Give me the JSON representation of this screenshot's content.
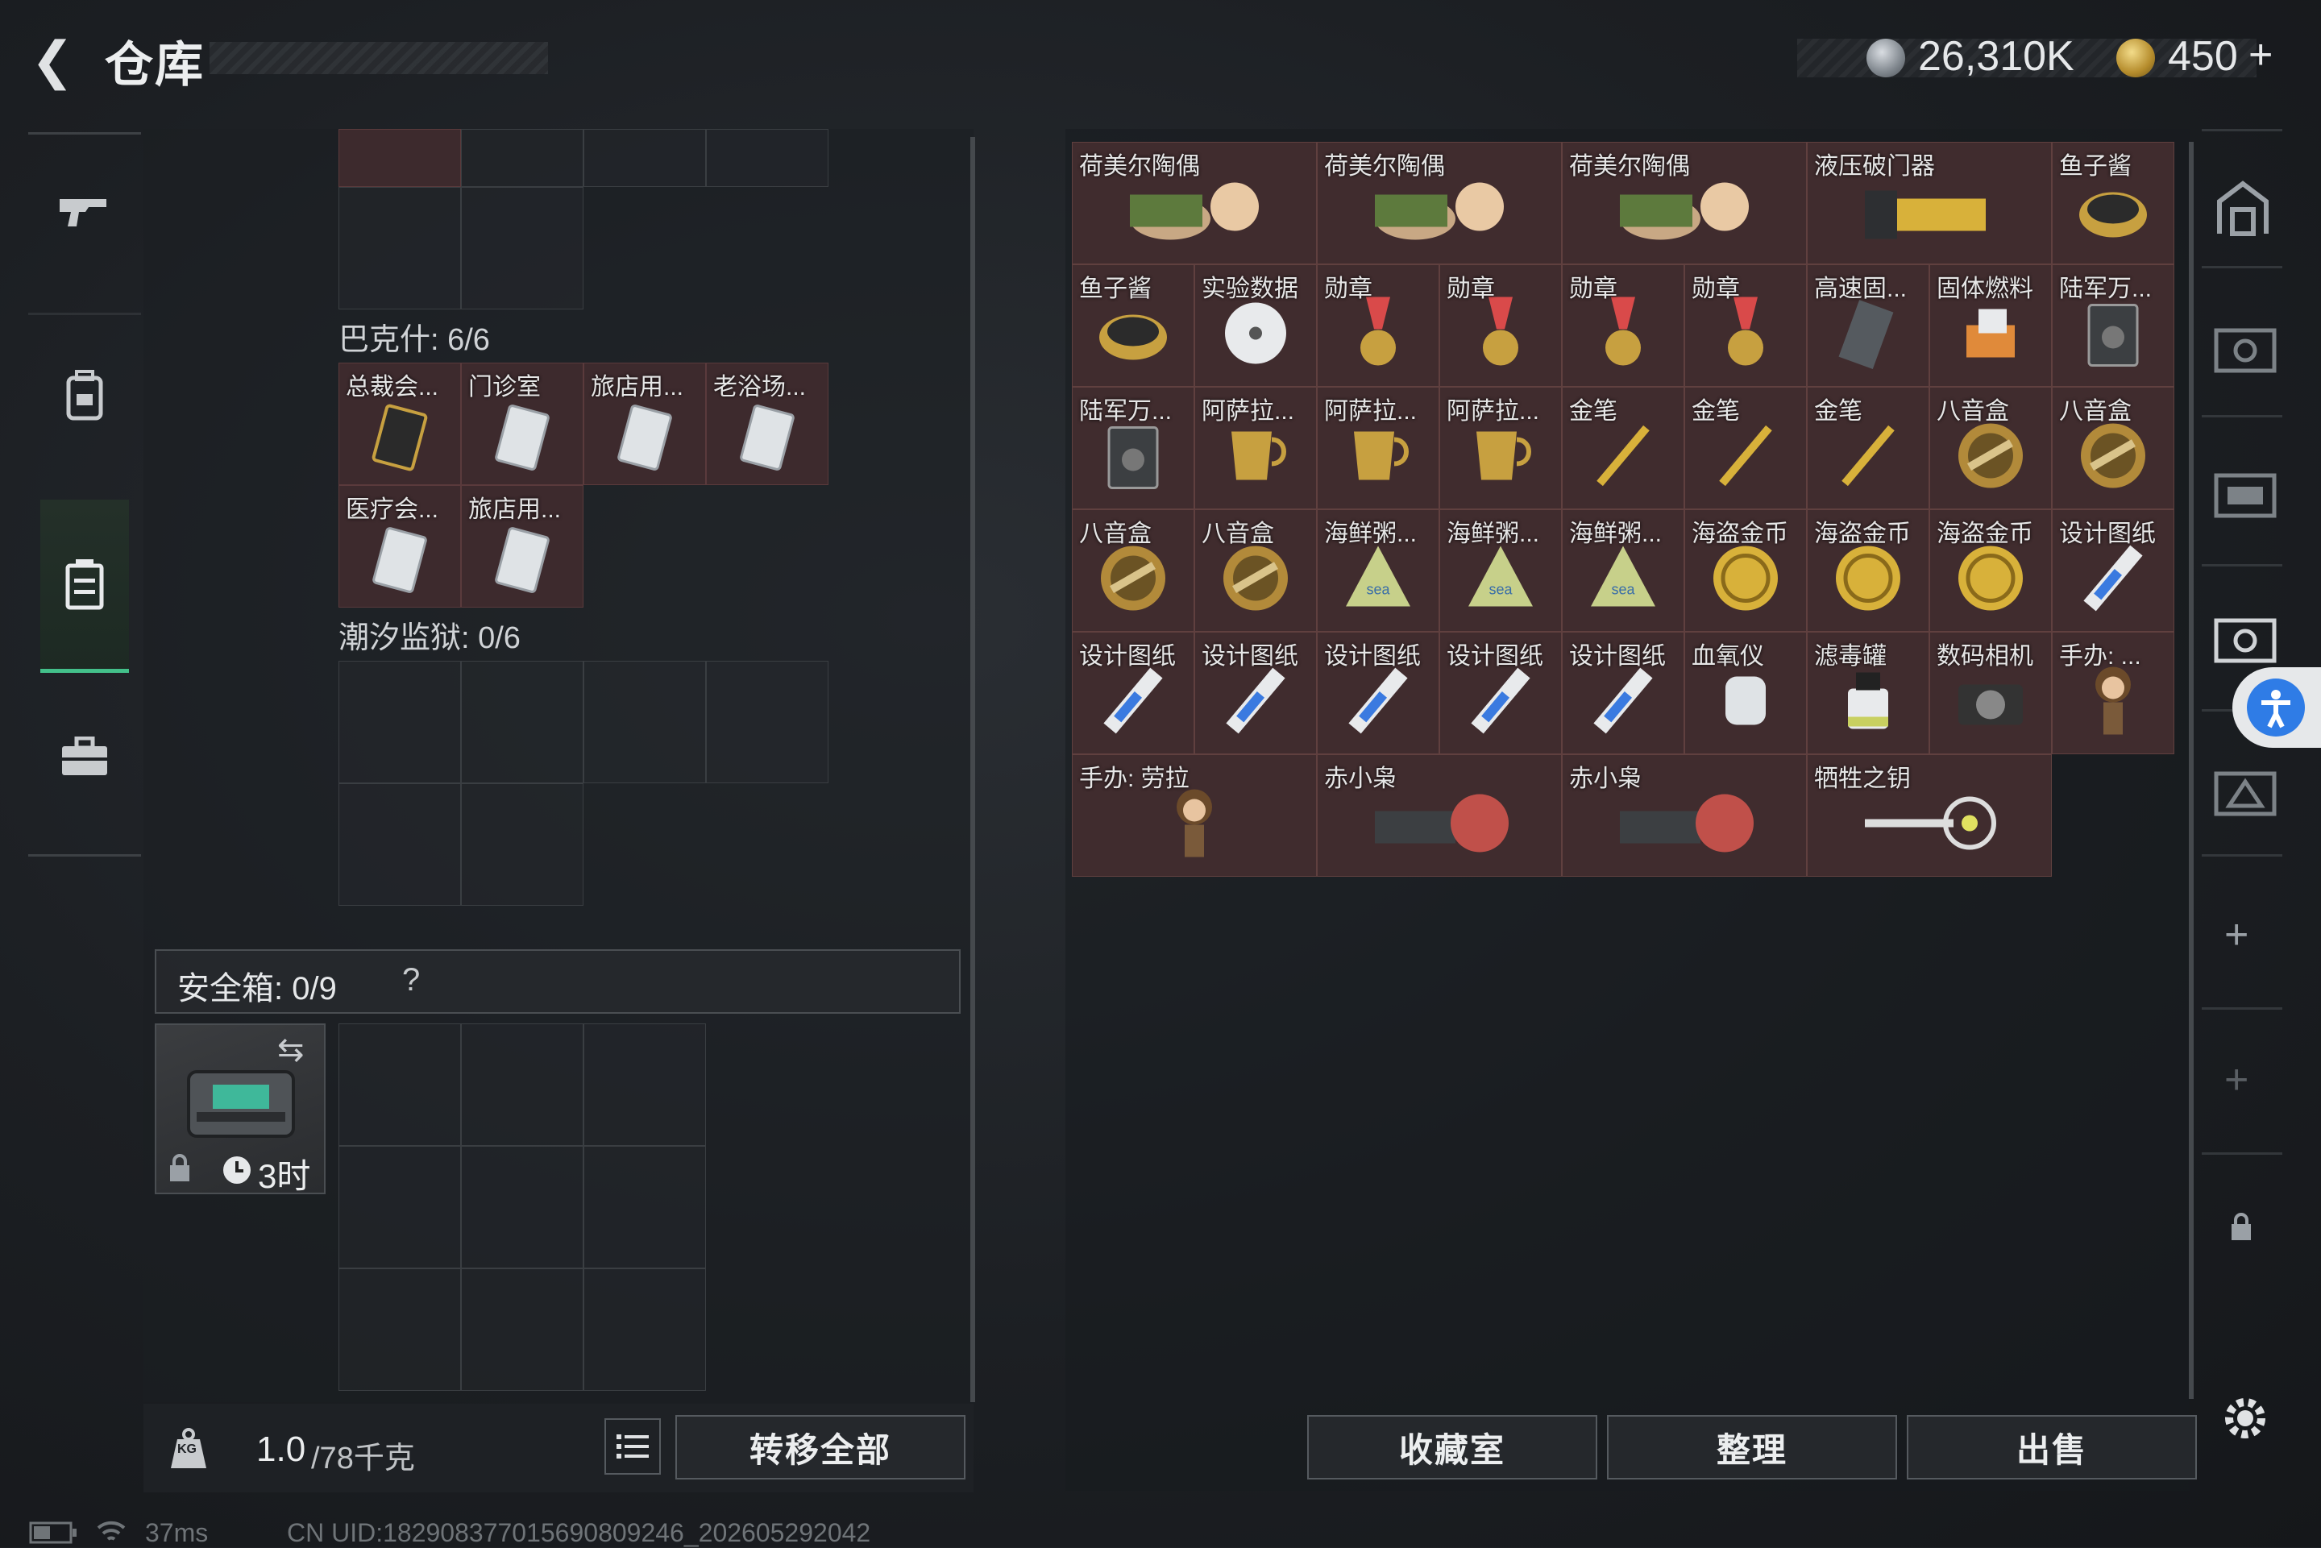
{
  "header": {
    "title": "仓库",
    "currency1": "26,310K",
    "currency2": "450",
    "currency2_plus": "+"
  },
  "left": {
    "section_baker": "巴克什: 6/6",
    "baker_items": [
      "总裁会...",
      "门诊室",
      "旅店用...",
      "老浴场...",
      "医疗会...",
      "旅店用..."
    ],
    "section_prison": "潮汐监狱: 0/6",
    "safebox_label": "安全箱: 0/9",
    "safebox_help": "?",
    "safebox_timer": "3时"
  },
  "bottom": {
    "weight_value": "1.0",
    "weight_unit": "/78千克",
    "transfer_all": "转移全部",
    "weight_icon_text": "KG"
  },
  "right": {
    "items": [
      "荷美尔陶偶",
      "荷美尔陶偶",
      "荷美尔陶偶",
      "液压破门器",
      "鱼子酱",
      "鱼子酱",
      "实验数据",
      "勋章",
      "勋章",
      "勋章",
      "勋章",
      "高速固...",
      "固体燃料",
      "陆军万...",
      "陆军万...",
      "阿萨拉...",
      "阿萨拉...",
      "阿萨拉...",
      "金笔",
      "金笔",
      "金笔",
      "八音盒",
      "八音盒",
      "八音盒",
      "八音盒",
      "海鲜粥...",
      "海鲜粥...",
      "海鲜粥...",
      "海盗金币",
      "海盗金币",
      "海盗金币",
      "设计图纸",
      "设计图纸",
      "设计图纸",
      "设计图纸",
      "设计图纸",
      "设计图纸",
      "血氧仪",
      "滤毒罐",
      "数码相机",
      "手办: ...",
      "手办: 劳拉",
      "赤小枭",
      "赤小枭",
      "牺牲之钥"
    ],
    "btn_collection": "收藏室",
    "btn_sort": "整理",
    "btn_sell": "出售"
  },
  "status": {
    "ping": "37ms",
    "uid": "CN UID:1829083770156908092​46_202605292042"
  }
}
